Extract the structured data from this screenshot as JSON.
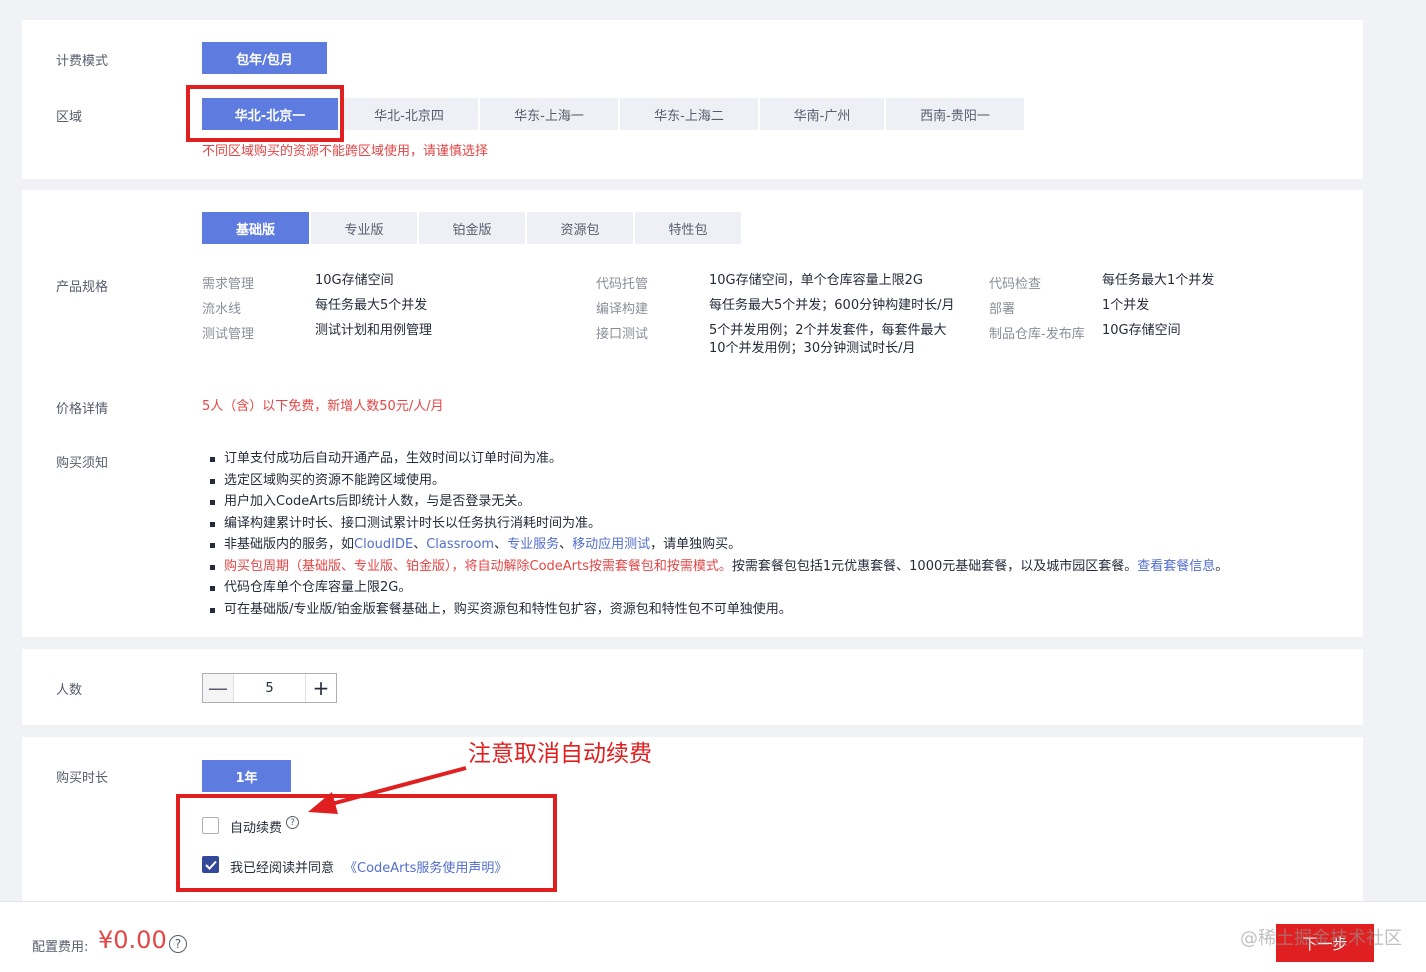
{
  "billing": {
    "label": "计费模式",
    "mode": "包年/包月"
  },
  "region": {
    "label": "区域",
    "options": [
      "华北-北京一",
      "华北-北京四",
      "华东-上海一",
      "华东-上海二",
      "华南-广州",
      "西南-贵阳一"
    ],
    "warning": "不同区域购买的资源不能跨区域使用，请谨慎选择"
  },
  "spec": {
    "label": "产品规格",
    "tabs": [
      "基础版",
      "专业版",
      "铂金版",
      "资源包",
      "特性包"
    ],
    "items": [
      {
        "key": "需求管理",
        "value": "10G存储空间"
      },
      {
        "key": "流水线",
        "value": "每任务最大5个并发"
      },
      {
        "key": "测试管理",
        "value": "测试计划和用例管理"
      },
      {
        "key": "代码托管",
        "value": "10G存储空间，单个仓库容量上限2G"
      },
      {
        "key": "编译构建",
        "value": "每任务最大5个并发；600分钟构建时长/月"
      },
      {
        "key": "接口测试",
        "value": "5个并发用例；2个并发套件，每套件最大"
      },
      {
        "key": "代码检查",
        "value": "每任务最大1个并发"
      },
      {
        "key": "部署",
        "value": "1个并发"
      },
      {
        "key": "制品仓库-发布库",
        "value": "10G存储空间"
      }
    ],
    "api_test_line2": "10个并发用例；30分钟测试时长/月"
  },
  "price": {
    "label": "价格详情",
    "text": "5人（含）以下免费，新增人数50元/人/月"
  },
  "notice": {
    "label": "购买须知",
    "line1": "订单支付成功后自动开通产品，生效时间以订单时间为准。",
    "line2": "选定区域购买的资源不能跨区域使用。",
    "line3": "用户加入CodeArts后即统计人数，与是否登录无关。",
    "line4": "编译构建累计时长、接口测试累计时长以任务执行消耗时间为准。",
    "line5_a": "非基础版内的服务，如",
    "line5_link1": "CloudIDE",
    "line5_sep1": "、",
    "line5_link2": "Classroom",
    "line5_sep2": "、",
    "line5_link3": "专业服务",
    "line5_sep3": "、",
    "line5_link4": "移动应用测试",
    "line5_b": "，请单独购买。",
    "line6_red": "购买包周期（基础版、专业版、铂金版），将自动解除CodeArts按需套餐包和按需模式。",
    "line6_b": "按需套餐包包括1元优惠套餐、1000元基础套餐，以及城市园区套餐。",
    "line6_link": "查看套餐信息",
    "line6_end": "。",
    "line7": "代码仓库单个仓库容量上限2G。",
    "line8": "可在基础版/专业版/铂金版套餐基础上，购买资源包和特性包扩容，资源包和特性包不可单独使用。"
  },
  "people": {
    "label": "人数",
    "minus": "—",
    "value": "5",
    "plus": "+"
  },
  "duration": {
    "label": "购买时长",
    "option": "1年",
    "auto_renew": "自动续费",
    "help": "?",
    "agree_prefix": "我已经阅读并同意",
    "agree_link": "《CodeArts服务使用声明》",
    "annotation": "注意取消自动续费"
  },
  "footer": {
    "fee_label": "配置费用:",
    "fee": "¥0.00",
    "help": "?",
    "next": "下一步",
    "watermark": "@稀土掘金技术社区"
  },
  "colors": {
    "accent": "#5e7ce0",
    "warning": "#e54545",
    "link": "#526ecc",
    "annotation_red": "#e02020"
  }
}
